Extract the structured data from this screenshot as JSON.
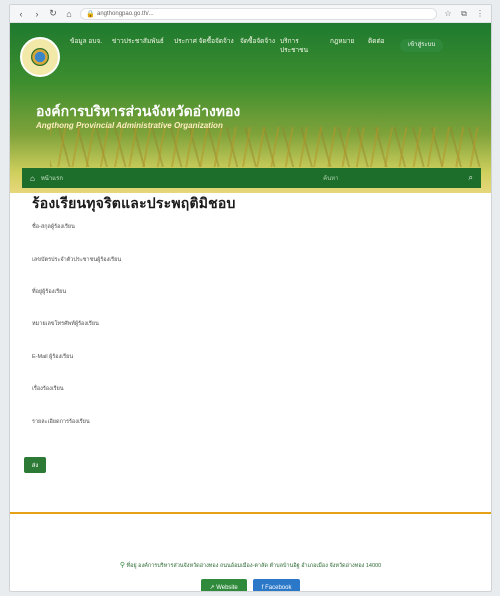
{
  "browser": {
    "back_icon": "‹",
    "forward_icon": "›",
    "reload_icon": "↻",
    "home_icon": "⌂",
    "url": "angthongpao.go.th/..."
  },
  "header": {
    "nav": [
      {
        "label": "ข้อมูล อบจ."
      },
      {
        "label": "ข่าวประชาสัมพันธ์"
      },
      {
        "label": "ประกาศ จัดซื้อจัดจ้าง"
      },
      {
        "label": "จัดซื้อจัดจ้าง"
      },
      {
        "label": "บริการประชาชน"
      },
      {
        "label": "กฎหมาย"
      },
      {
        "label": "ติดต่อ"
      }
    ],
    "contact_button": "เข้าสู่ระบบ",
    "title": "องค์การบริหารส่วนจังหวัดอ่างทอง",
    "subtitle": "Angthong Provincial Administrative Organization"
  },
  "breadbar": {
    "crumb": "หน้าแรก",
    "search_placeholder": "ค้นหา"
  },
  "form": {
    "title": "ร้องเรียนทุจริตและประพฤติมิชอบ",
    "fields": [
      {
        "label": "ชื่อ-สกุลผู้ร้องเรียน"
      },
      {
        "label": "เลขบัตรประจำตัวประชาชนผู้ร้องเรียน"
      },
      {
        "label": "ที่อยู่ผู้ร้องเรียน"
      },
      {
        "label": "หมายเลขโทรศัพท์ผู้ร้องเรียน"
      },
      {
        "label": "E-Mail ผู้ร้องเรียน"
      },
      {
        "label": "เรื่องร้องเรียน"
      },
      {
        "label": "รายละเอียดการร้องเรียน"
      }
    ],
    "submit_label": "ส่ง"
  },
  "footer": {
    "address": "ที่อยู่ องค์การบริหารส่วนจังหวัดอ่างทอง ถนนอ้อมเมือง-ตาลัด ตำบลบ้านอิฐ อำเภอเมือง จังหวัดอ่างทอง 14000",
    "website_label": "Website",
    "facebook_label": "Facebook"
  },
  "colors": {
    "header_green": "#1f7a2f",
    "accent_orange": "#e6a117",
    "button_green": "#2c7a36",
    "facebook_blue": "#2b78c9"
  }
}
